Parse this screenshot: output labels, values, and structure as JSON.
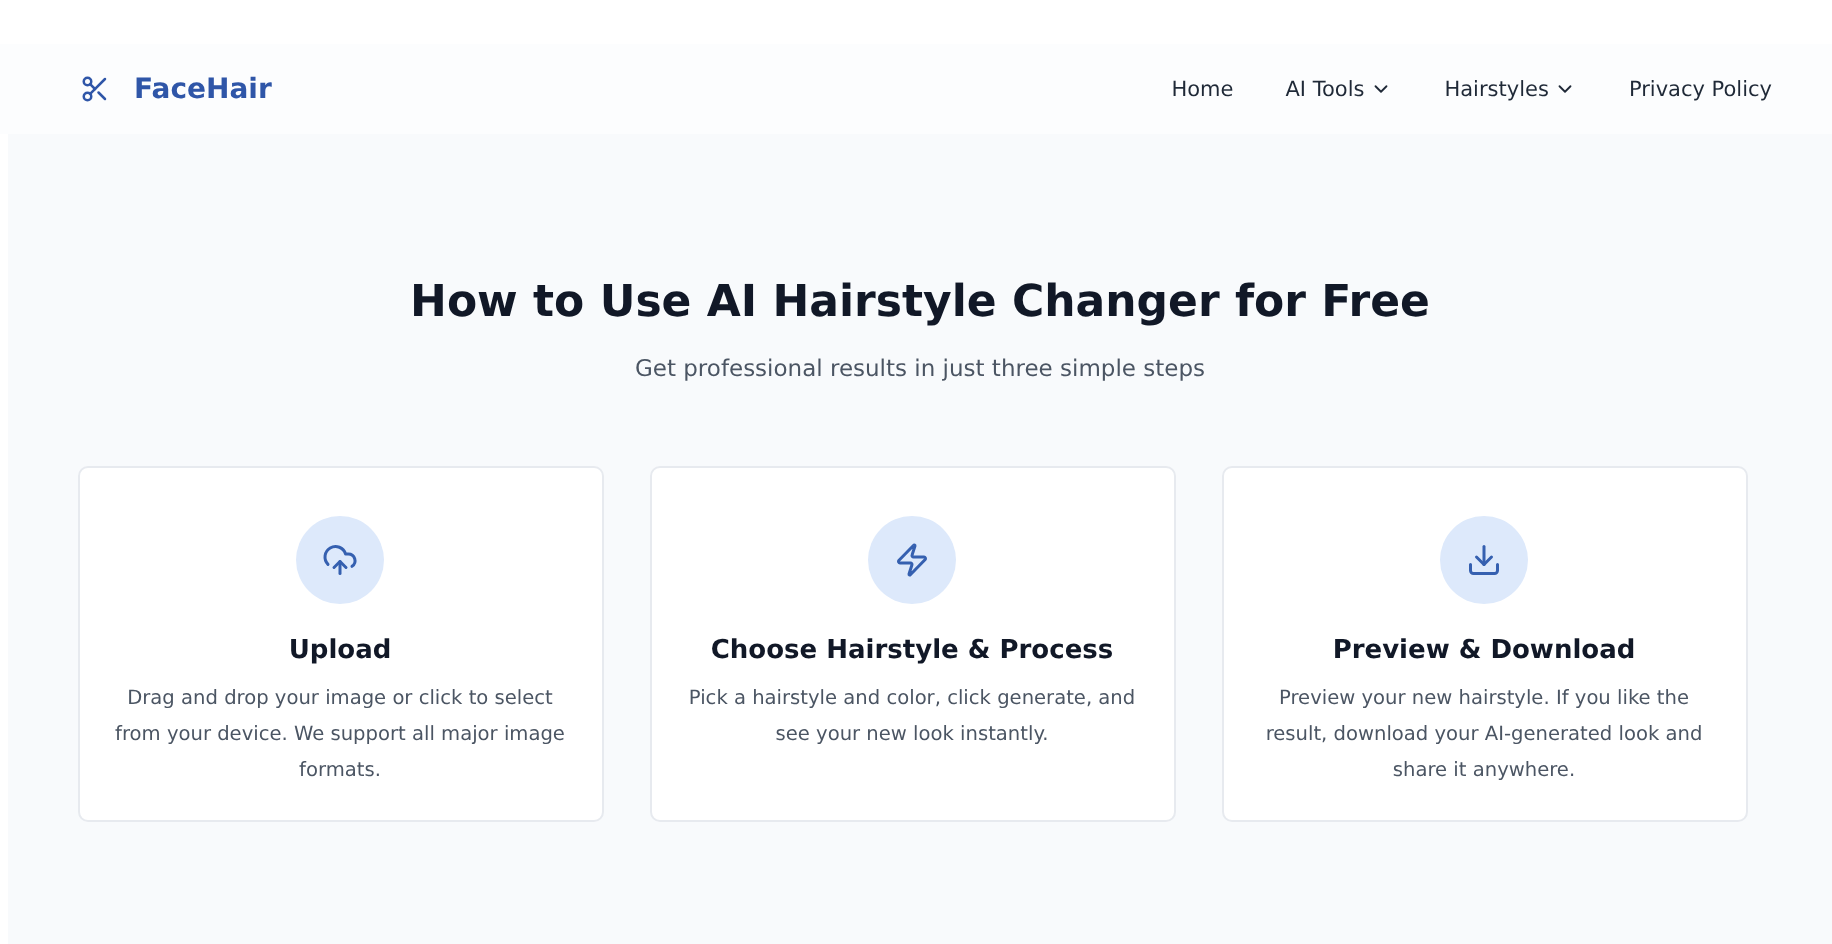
{
  "header": {
    "logo": "FaceHair",
    "nav": [
      {
        "label": "Home",
        "kind": "link"
      },
      {
        "label": "AI Tools",
        "kind": "dropdown"
      },
      {
        "label": "Hairstyles",
        "kind": "dropdown"
      },
      {
        "label": "Privacy Policy",
        "kind": "link"
      }
    ]
  },
  "section": {
    "title": "How to Use AI Hairstyle Changer for Free",
    "subtitle": "Get professional results in just three simple steps",
    "steps": [
      {
        "kind": "upload",
        "title": "Upload",
        "description": "Drag and drop your image or click to select from your device. We support all major image formats."
      },
      {
        "kind": "bolt",
        "title": "Choose Hairstyle & Process",
        "description": "Pick a hairstyle and color, click generate, and see your new look instantly."
      },
      {
        "kind": "download",
        "title": "Preview & Download",
        "description": "Preview your new hairstyle. If you like the result, download your AI-generated look and share it anywhere."
      }
    ]
  }
}
